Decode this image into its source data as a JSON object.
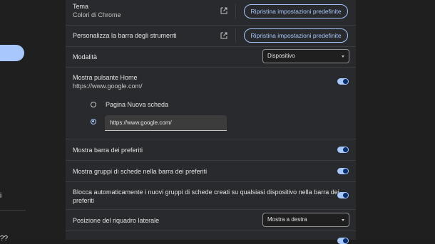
{
  "sidebar": {
    "fragment_top": "i",
    "fragment_bottom": "??"
  },
  "settings": {
    "theme": {
      "label": "Tema",
      "value": "Colori di Chrome",
      "reset_label": "Ripristina impostazioni predefinite"
    },
    "customize_toolbar": {
      "label": "Personalizza la barra degli strumenti",
      "reset_label": "Ripristina impostazioni predefinite"
    },
    "mode": {
      "label": "Modalità",
      "selected": "Dispositivo"
    },
    "home_button": {
      "label": "Mostra pulsante Home",
      "sublabel": "https://www.google.com/",
      "enabled": true,
      "options": [
        {
          "label": "Pagina Nuova scheda",
          "checked": false
        },
        {
          "value": "https://www.google.com/",
          "checked": true
        }
      ]
    },
    "bookmarks_bar": {
      "label": "Mostra barra dei preferiti",
      "enabled": true
    },
    "tab_groups": {
      "label": "Mostra gruppi di schede nella barra dei preferiti",
      "enabled": true
    },
    "auto_pin": {
      "label_line1": "Blocca automaticamente i nuovi gruppi di schede creati su qualsiasi dispositivo nella barra dei",
      "label_line2": "preferiti",
      "enabled": true
    },
    "side_panel": {
      "label": "Posizione del riquadro laterale",
      "selected": "Mostra a destra"
    }
  },
  "colors": {
    "accent": "#a8c7fa",
    "panel": "#292a2d",
    "background": "#1f1f1f"
  }
}
